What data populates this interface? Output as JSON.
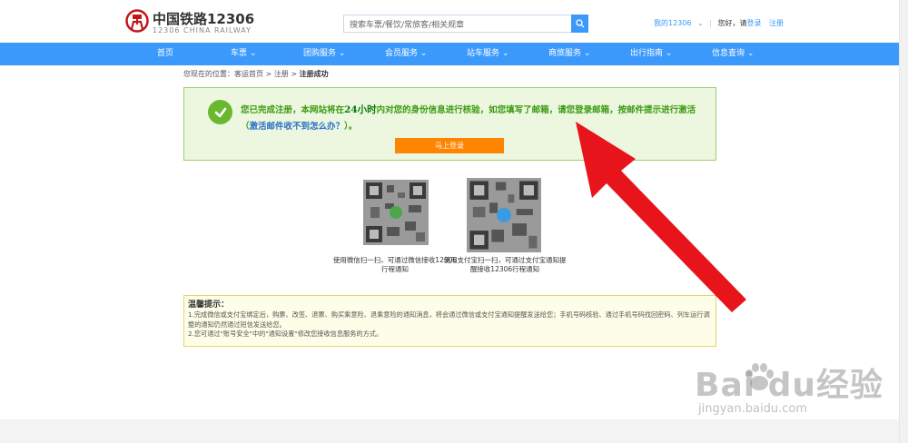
{
  "header": {
    "logo_cn": "中国铁路12306",
    "logo_en": "12306 CHINA RAILWAY",
    "search_placeholder": "搜索车票/餐饮/常旅客/相关规章",
    "my_account": "我的12306",
    "greeting": "您好，请",
    "login": "登录",
    "register": "注册"
  },
  "nav": {
    "items": [
      {
        "label": "首页"
      },
      {
        "label": "车票"
      },
      {
        "label": "团购服务"
      },
      {
        "label": "会员服务"
      },
      {
        "label": "站车服务"
      },
      {
        "label": "商旅服务"
      },
      {
        "label": "出行指南"
      },
      {
        "label": "信息查询"
      }
    ]
  },
  "breadcrumb": {
    "prefix": "您现在的位置：",
    "home": "客运首页",
    "sep1": " > ",
    "register": "注册",
    "sep2": " > ",
    "current": "注册成功"
  },
  "success": {
    "text_a": "您已完成注册，本网站将在",
    "hours": "24小时",
    "text_b": "内对您的身份信息进行核验，如您填写了邮箱，请您登录邮箱，按邮件提示进行激活",
    "link_open": "（",
    "link": "激活邮件收不到怎么办？",
    "link_close": "）。",
    "button": "马上登录"
  },
  "qr": {
    "wechat_caption": "使用微信扫一扫，可通过微信接收12306行程通知",
    "alipay_caption": "使用支付宝扫一扫，可通过支付宝通知提醒接收12306行程通知"
  },
  "tips": {
    "title": "温馨提示：",
    "line1": "1.完成微信或支付宝绑定后，购票、改签、退票、购买乘意险、退乘意险的通知消息，将会通过微信或支付宝通知提醒发送给您；手机号码核验、通过手机号码找回密码、列车运行调整的通知仍然通过短信发送给您。",
    "line2": "2.您可通过\"账号安全\"中的\"通知设置\"修改您接收信息服务的方式。"
  },
  "watermark": {
    "brand": "Bai  du经验",
    "url": "jingyan.baidu.com"
  },
  "colors": {
    "nav_blue": "#3b99fc",
    "success_green": "#3a9a10",
    "button_orange": "#ff8400",
    "arrow_red": "#e8141c"
  }
}
